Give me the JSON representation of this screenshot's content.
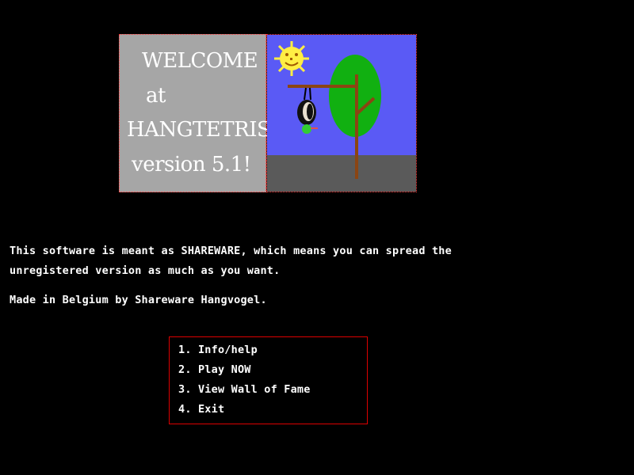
{
  "banner": {
    "welcome_lines": [
      "WELCOME",
      "at",
      "HANGTETRIS",
      "version 5.1!"
    ],
    "colors": {
      "sky": "#5a5af5",
      "ground": "#5a5a5a",
      "panel": "#a6a6a6",
      "border": "#ff3b3b",
      "sun": "#ffee44",
      "tree": "#11b011",
      "branch": "#8b4513"
    },
    "icons": [
      "sun-icon",
      "tree-icon",
      "gallows-icon",
      "hanging-bird-icon"
    ]
  },
  "text": {
    "shareware_line1": "This software is meant as SHAREWARE, which means you can spread the",
    "shareware_line2": "unregistered version as much as you want.",
    "made_in": "Made in Belgium by Shareware Hangvogel."
  },
  "menu": {
    "items": [
      {
        "label": "1. Info/help"
      },
      {
        "label": "2. Play NOW"
      },
      {
        "label": "3. View Wall of Fame"
      },
      {
        "label": "4. Exit"
      }
    ],
    "border_color": "#dd0000"
  }
}
